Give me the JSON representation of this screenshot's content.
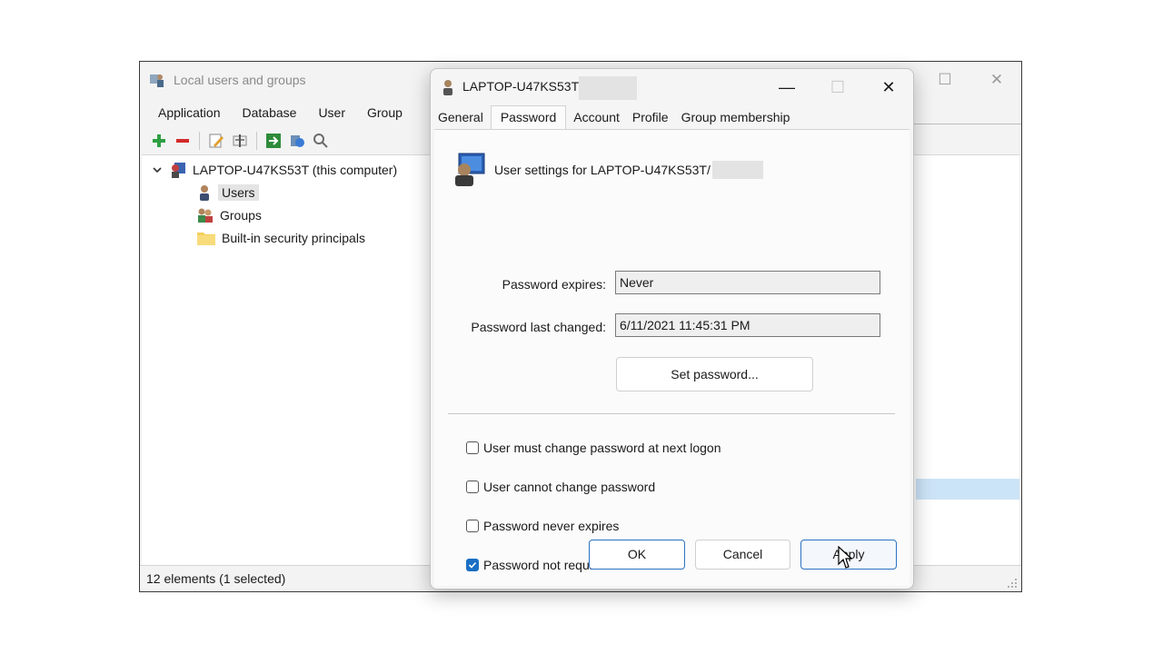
{
  "main_window": {
    "title": "Local users and groups",
    "controls": {
      "maximize": "☐",
      "close": "✕"
    },
    "menu": [
      "Application",
      "Database",
      "User",
      "Group"
    ],
    "toolbar_icons": [
      "add-icon",
      "remove-icon",
      "edit-icon",
      "properties-icon",
      "export-icon",
      "refresh-icon",
      "search-icon"
    ],
    "tree": {
      "computer": "LAPTOP-U47KS53T (this computer)",
      "items": [
        {
          "label": "Users",
          "icon": "users-icon",
          "selected": true
        },
        {
          "label": "Groups",
          "icon": "groups-icon",
          "selected": false
        },
        {
          "label": "Built-in security principals",
          "icon": "folder-icon",
          "selected": false
        }
      ]
    },
    "status": "12 elements  (1 selected)"
  },
  "dialog": {
    "title": "LAPTOP-U47KS53T/",
    "controls": {
      "minimize": "—",
      "maximize": "☐",
      "close": "✕"
    },
    "tabs": [
      "General",
      "Password",
      "Account",
      "Profile",
      "Group membership"
    ],
    "active_tab": "Password",
    "heading": "User settings for LAPTOP-U47KS53T/",
    "password_expires_label": "Password expires:",
    "password_expires_value": "Never",
    "password_last_changed_label": "Password last changed:",
    "password_last_changed_value": "6/11/2021 11:45:31 PM",
    "set_password_label": "Set password...",
    "checkboxes": [
      {
        "label": "User must change password at next logon",
        "checked": false
      },
      {
        "label": "User cannot change password",
        "checked": false
      },
      {
        "label": "Password never expires",
        "checked": false
      },
      {
        "label": "Password not required",
        "checked": true
      }
    ],
    "buttons": {
      "ok": "OK",
      "cancel": "Cancel",
      "apply": "Apply"
    }
  },
  "colors": {
    "accent": "#1a6fc4",
    "selection": "#cce4f7"
  }
}
